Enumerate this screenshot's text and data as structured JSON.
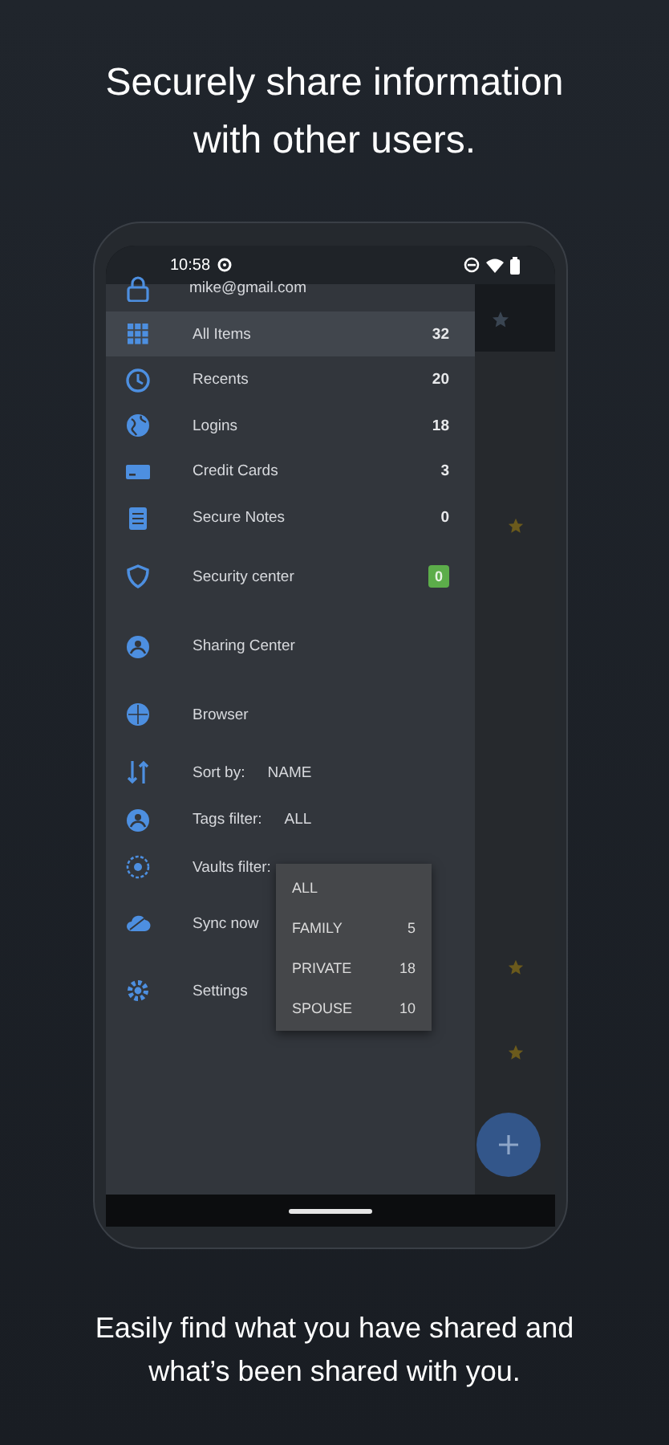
{
  "headline": "Securely share information with other users.",
  "caption": "Easily find what you have shared and what’s been shared with you.",
  "status_bar": {
    "time": "10:58"
  },
  "account": {
    "email": "mike@gmail.com"
  },
  "menu": [
    {
      "kind": "count",
      "label": "All Items",
      "count": "32",
      "selected": true
    },
    {
      "kind": "count",
      "label": "Recents",
      "count": "20",
      "selected": false
    },
    {
      "kind": "count",
      "label": "Logins",
      "count": "18",
      "selected": false
    },
    {
      "kind": "count",
      "label": "Credit Cards",
      "count": "3",
      "selected": false
    },
    {
      "kind": "count",
      "label": "Secure Notes",
      "count": "0",
      "selected": false
    },
    {
      "kind": "badge",
      "label": "Security center",
      "count": "0",
      "color": "#5cad4a",
      "selected": false
    },
    {
      "kind": "plain",
      "label": "Sharing Center",
      "selected": false
    },
    {
      "kind": "plain",
      "label": "Browser",
      "selected": false
    },
    {
      "kind": "value",
      "label": "Sort by:",
      "value": "NAME",
      "selected": false
    },
    {
      "kind": "value",
      "label": "Tags filter:",
      "value": "ALL",
      "selected": false
    },
    {
      "kind": "value",
      "label": "Vaults filter:",
      "selected": false
    },
    {
      "kind": "plain",
      "label": "Sync now",
      "selected": false
    },
    {
      "kind": "plain",
      "label": "Settings",
      "selected": false
    }
  ],
  "vault_menu": [
    {
      "label": "ALL"
    },
    {
      "label": "FAMILY",
      "count": "5"
    },
    {
      "label": "PRIVATE",
      "count": "18"
    },
    {
      "label": "SPOUSE",
      "count": "10"
    }
  ]
}
